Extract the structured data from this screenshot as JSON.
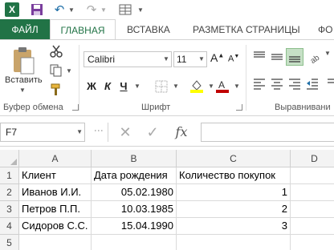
{
  "quick_access": {
    "app_logo": "X",
    "icons": [
      "excel-logo-icon",
      "save-icon",
      "undo-icon",
      "redo-icon",
      "quick-access-customize-icon"
    ]
  },
  "tabs": {
    "file": "ФАЙЛ",
    "home": "ГЛАВНАЯ",
    "insert": "ВСТАВКА",
    "page_layout": "РАЗМЕТКА СТРАНИЦЫ",
    "formulas": "ФО"
  },
  "ribbon": {
    "clipboard": {
      "paste_label": "Вставить",
      "group_label": "Буфер обмена"
    },
    "font": {
      "font_name": "Calibri",
      "font_size": "11",
      "grow_label": "A",
      "shrink_label": "A",
      "bold_label": "Ж",
      "italic_label": "К",
      "underline_label": "Ч",
      "group_label": "Шрифт"
    },
    "alignment": {
      "group_label": "Выравнивани"
    }
  },
  "formula_bar": {
    "name_box": "F7",
    "fx_label": "fx",
    "formula": ""
  },
  "sheet": {
    "columns": [
      "A",
      "B",
      "C",
      "D"
    ],
    "rows": [
      "1",
      "2",
      "3",
      "4",
      "5"
    ],
    "cells": [
      [
        "Клиент",
        "Дата рождения",
        "Количество покупок",
        ""
      ],
      [
        "Иванов И.И.",
        "05.02.1980",
        "1",
        ""
      ],
      [
        "Петров П.П.",
        "10.03.1985",
        "2",
        ""
      ],
      [
        "Сидоров С.С.",
        "15.04.1990",
        "3",
        ""
      ],
      [
        "",
        "",
        "",
        ""
      ]
    ]
  },
  "colors": {
    "excel_green": "#217346",
    "accent_blue": "#1e6ea7",
    "font_color_red": "#c00000",
    "fill_yellow": "#ffff00"
  }
}
